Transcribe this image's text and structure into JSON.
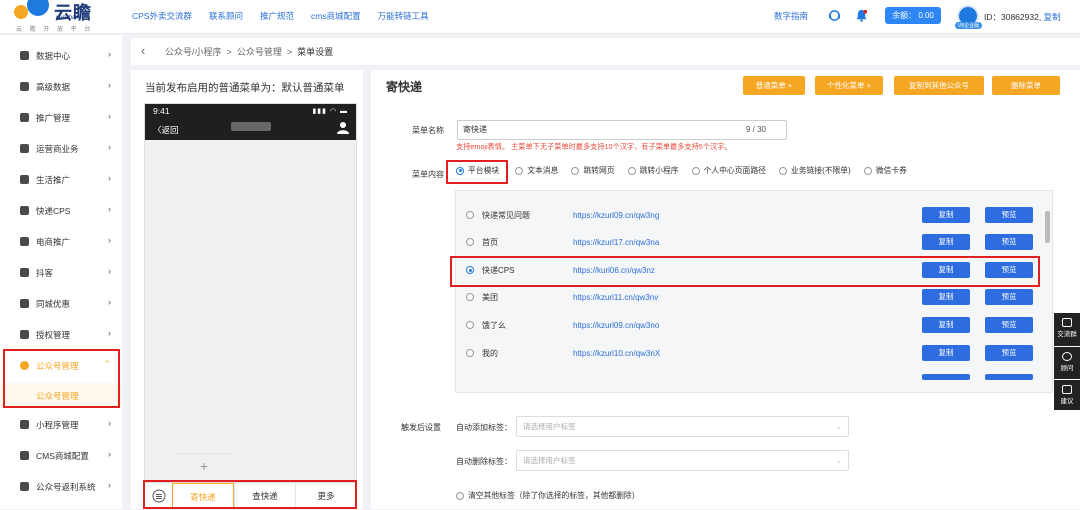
{
  "brand": {
    "name": "云瞻",
    "sub": "yunzhan",
    "tag": "云 瞻 开 放 平 台"
  },
  "topnav": [
    "CPS外卖交流群",
    "联系顾问",
    "推广规范",
    "cms商城配置",
    "万能转链工具"
  ],
  "header": {
    "guide": "数字指南",
    "balance": "余额： 0.00",
    "vip": "V8企业版",
    "uid": "ID：30862932,",
    "copy": "复制"
  },
  "sidebar": [
    "数据中心",
    "高级数据",
    "推广管理",
    "运营商业务",
    "生活推广",
    "快递CPS",
    "电商推广",
    "抖客",
    "同城优惠",
    "授权管理",
    "公众号管理",
    "小程序管理",
    "CMS商城配置",
    "公众号返利系统"
  ],
  "sidebar_sub": "公众号管理",
  "crumb": {
    "p1": "公众号/小程序",
    "p2": "公众号管理",
    "p3": "菜单设置",
    "sep": ">"
  },
  "left": {
    "title": "当前发布启用的普通菜单为：默认普通菜单",
    "time": "9:41",
    "back": "〈返回",
    "plus": "+",
    "tabs": [
      "寄快递",
      "查快递",
      "更多"
    ]
  },
  "right": {
    "title": "寄快递",
    "buttons": [
      "普通菜单 +",
      "个性化菜单 +",
      "复制到其他公众号",
      "删除菜单"
    ],
    "name_label": "菜单名称",
    "name_value": "寄快递",
    "name_count": "9 / 30",
    "tip": "支持emoji表情。 主菜单下无子菜单时最多支持10个汉字，有子菜单最多支持5个汉字。",
    "content_label": "菜单内容",
    "options": [
      "平台模块",
      "文本消息",
      "跳转网页",
      "跳转小程序",
      "个人中心页面路径",
      "业务链接(不限单)",
      "微信卡券"
    ],
    "rows": [
      {
        "name": "快递常见问题",
        "url": "https://kzurl09.cn/qw3ng"
      },
      {
        "name": "首页",
        "url": "https://kzurl17.cn/qw3na"
      },
      {
        "name": "快递CPS",
        "url": "https://kurl06.cn/qw3nz"
      },
      {
        "name": "美团",
        "url": "https://kzurl11.cn/qw3nv"
      },
      {
        "name": "饿了么",
        "url": "https://kzurl09.cn/qw3no"
      },
      {
        "name": "我的",
        "url": "https://kzurl10.cn/qw3nX"
      }
    ],
    "copy_btn": "复制",
    "preview_btn": "预览",
    "trigger_label": "触发后设置",
    "add_tag": "自动添加标签：",
    "del_tag": "自动删除标签：",
    "tag_placeholder": "请选择用户标签",
    "clear": "清空其他标签（除了你选择的标签，其他都删除）"
  },
  "float": [
    "交流群",
    "顾问",
    "建议"
  ]
}
